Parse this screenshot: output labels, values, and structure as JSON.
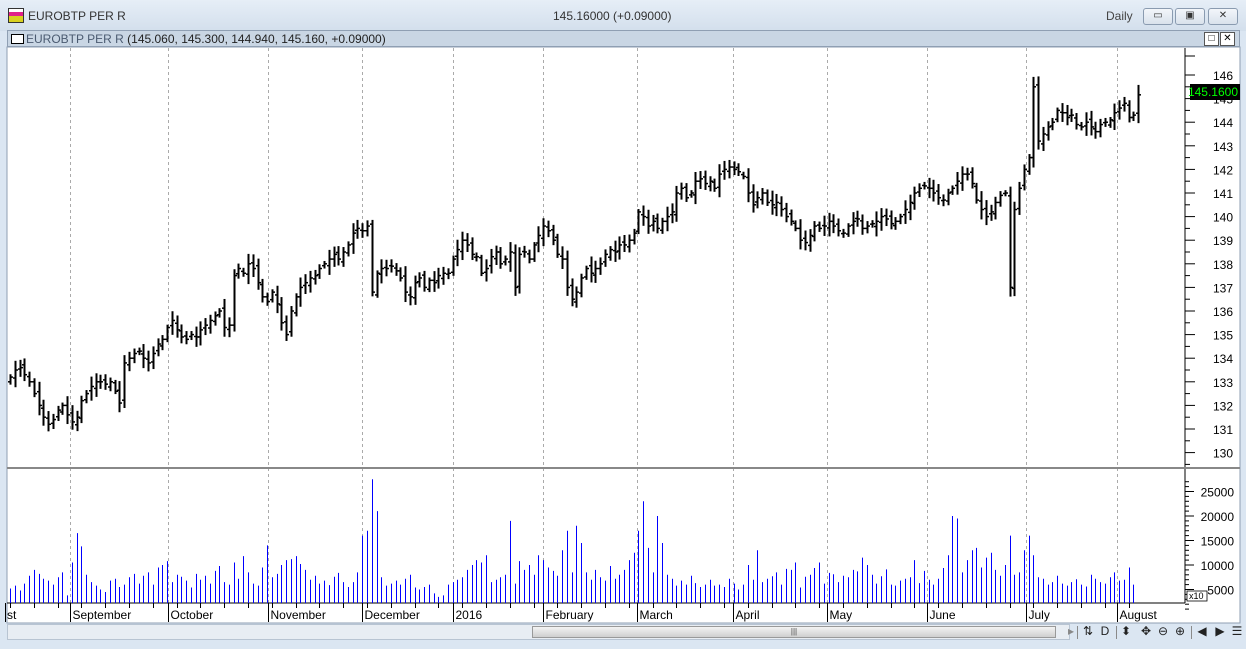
{
  "window": {
    "title": "EUROBTP PER R",
    "last_price_header": "145.16000 (+0.09000)",
    "period": "Daily",
    "minimize": "▭",
    "restore": "▣",
    "close": "✕"
  },
  "chart_window": {
    "symbol": "EUROBTP PER R",
    "ohlc_text": "(145.060, 145.300, 144.940, 145.160, +0.09000)",
    "maximize": "□",
    "close": "✕"
  },
  "chart_data": {
    "type": "ohlc",
    "series_name": "EUROBTP PER R",
    "current_price_label": "145.1600",
    "y_ticks": [
      "130",
      "131",
      "132",
      "133",
      "134",
      "135",
      "136",
      "137",
      "138",
      "139",
      "140",
      "141",
      "142",
      "143",
      "144",
      "145",
      "146"
    ],
    "ylim": [
      129.6,
      147
    ],
    "closes": [
      133.2,
      133.5,
      133.6,
      133.3,
      133.0,
      132.5,
      132.0,
      131.5,
      131.2,
      131.4,
      131.8,
      132.0,
      131.6,
      131.3,
      131.5,
      132.2,
      132.5,
      132.8,
      133.0,
      133.0,
      132.9,
      133.0,
      132.6,
      132.1,
      133.8,
      134.0,
      134.2,
      134.3,
      134.0,
      133.8,
      134.2,
      134.6,
      134.8,
      135.3,
      135.6,
      135.2,
      134.9,
      134.8,
      135.0,
      134.9,
      135.2,
      135.4,
      135.6,
      135.8,
      136.0,
      135.3,
      135.4,
      137.5,
      137.8,
      137.6,
      138.0,
      137.8,
      137.2,
      136.6,
      136.4,
      136.8,
      136.3,
      135.5,
      135.0,
      136.0,
      136.6,
      137.0,
      137.2,
      137.4,
      137.5,
      137.8,
      138.0,
      138.2,
      138.4,
      138.2,
      138.5,
      138.8,
      139.3,
      139.5,
      139.4,
      139.6,
      136.8,
      137.6,
      137.8,
      137.8,
      137.9,
      137.7,
      137.4,
      136.8,
      136.6,
      137.2,
      137.4,
      137.0,
      137.3,
      137.2,
      137.5,
      137.6,
      137.6,
      138.2,
      138.6,
      139.0,
      138.8,
      138.4,
      138.3,
      137.6,
      137.8,
      138.3,
      138.5,
      138.0,
      138.2,
      138.5,
      137.0,
      138.4,
      138.5,
      138.2,
      138.8,
      139.2,
      139.6,
      139.4,
      139.0,
      138.4,
      138.2,
      137.0,
      136.5,
      136.8,
      137.4,
      137.8,
      137.6,
      137.8,
      138.0,
      138.4,
      138.6,
      138.5,
      138.8,
      138.8,
      139.0,
      139.3,
      140.2,
      140.0,
      139.6,
      139.8,
      139.5,
      139.8,
      140.0,
      140.2,
      141.0,
      141.2,
      140.8,
      141.0,
      141.5,
      141.6,
      141.4,
      141.5,
      141.2,
      141.8,
      142.0,
      142.1,
      142.0,
      141.9,
      141.7,
      141.0,
      140.5,
      140.8,
      141.0,
      140.6,
      140.5,
      140.6,
      140.3,
      140.0,
      139.8,
      139.5,
      139.0,
      138.9,
      139.2,
      139.6,
      139.5,
      139.6,
      139.8,
      139.6,
      139.4,
      139.3,
      139.6,
      139.8,
      139.9,
      139.5,
      139.6,
      139.7,
      139.8,
      140.0,
      139.9,
      139.7,
      139.8,
      140.0,
      140.3,
      140.6,
      141.0,
      141.2,
      141.3,
      141.2,
      141.0,
      140.8,
      140.7,
      141.0,
      141.2,
      141.5,
      141.8,
      141.8,
      141.4,
      140.7,
      140.3,
      140.0,
      140.2,
      140.6,
      140.9,
      141.0,
      137.0,
      140.3,
      141.2,
      142.0,
      142.5,
      145.5,
      143.2,
      143.5,
      143.8,
      144.0,
      144.5,
      144.4,
      144.2,
      144.3,
      143.9,
      143.8,
      144.0,
      143.8,
      143.6,
      143.9,
      144.0,
      144.1,
      144.4,
      144.6,
      144.8,
      144.2,
      144.3,
      145.16
    ],
    "volume": {
      "y_ticks": [
        "5000",
        "10000",
        "15000",
        "20000",
        "25000"
      ],
      "multiplier_label": "x10",
      "values": [
        5200,
        5800,
        4800,
        6200,
        7800,
        9000,
        8200,
        7200,
        6800,
        6000,
        7500,
        8500,
        3800,
        10500,
        16500,
        13800,
        8000,
        6500,
        5800,
        5000,
        4500,
        6800,
        7200,
        5500,
        6000,
        7500,
        8200,
        6200,
        7800,
        8500,
        6000,
        9500,
        10000,
        10800,
        6500,
        8000,
        7600,
        6800,
        5400,
        8200,
        7000,
        7800,
        6200,
        8800,
        9800,
        6500,
        6000,
        10500,
        7200,
        11800,
        8500,
        6200,
        5800,
        9500,
        14000,
        7500,
        8200,
        10000,
        11000,
        11200,
        11800,
        10200,
        9000,
        7000,
        7800,
        6200,
        6800,
        5900,
        7600,
        8400,
        6500,
        5500,
        6500,
        8500,
        16000,
        17000,
        27500,
        21000,
        7500,
        5800,
        6200,
        6800,
        6000,
        7200,
        8000,
        5400,
        5000,
        5500,
        6000,
        4200,
        3500,
        3800,
        6000,
        6500,
        7000,
        7500,
        9000,
        10000,
        11000,
        10500,
        12000,
        6500,
        7000,
        7500,
        8000,
        19000,
        6200,
        10800,
        9000,
        10000,
        8000,
        12000,
        11000,
        9500,
        8800,
        7800,
        13000,
        17000,
        8500,
        18000,
        14500,
        8500,
        7000,
        9000,
        7500,
        6800,
        9800,
        7200,
        8000,
        9000,
        11000,
        12500,
        17000,
        23000,
        13500,
        8500,
        20000,
        14500,
        8000,
        7200,
        5800,
        6800,
        6000,
        7800,
        6300,
        5500,
        6000,
        7000,
        5800,
        6000,
        5500,
        7200,
        6200,
        5000,
        6000,
        10000,
        7000,
        13000,
        6500,
        7200,
        7700,
        8500,
        6000,
        9200,
        9000,
        10500,
        5400,
        7600,
        8000,
        9400,
        10500,
        6200,
        8400,
        8100,
        6500,
        7800,
        7500,
        9000,
        8700,
        11500,
        10000,
        8000,
        6200,
        7700,
        9100,
        6000,
        5800,
        6800,
        7200,
        7500,
        11000,
        6300,
        8800,
        7000,
        6000,
        7200,
        9400,
        12000,
        20000,
        19500,
        8500,
        11000,
        13000,
        13500,
        9500,
        11500,
        12500,
        9000,
        7800,
        10000,
        16000,
        8000,
        8500,
        13000,
        16000,
        12000,
        7500,
        7200,
        6000,
        6500,
        7800,
        6200,
        5800,
        6500,
        7100,
        6000,
        5600,
        8000,
        7200,
        6500,
        6200,
        7500,
        8500,
        6800,
        7000,
        9500,
        6000
      ]
    },
    "x_labels": [
      {
        "label": "st",
        "bar": -1
      },
      {
        "label": "September",
        "bar": 12.6
      },
      {
        "label": "October",
        "bar": 33.2
      },
      {
        "label": "November",
        "bar": 54.2
      },
      {
        "label": "December",
        "bar": 74
      },
      {
        "label": "2016",
        "bar": 93
      },
      {
        "label": "February",
        "bar": 112
      },
      {
        "label": "March",
        "bar": 131.7
      },
      {
        "label": "April",
        "bar": 151.9
      },
      {
        "label": "May",
        "bar": 171.6
      },
      {
        "label": "June",
        "bar": 192.6
      },
      {
        "label": "July",
        "bar": 213.4
      },
      {
        "label": "August",
        "bar": 232.6
      }
    ]
  },
  "toolbar": {
    "scroll_right": "▸",
    "refresh": "⇅",
    "data": "D",
    "vzoom": "⬍",
    "move": "✥",
    "zoom_out": "⊖",
    "zoom_in": "⊕",
    "prev": "◀",
    "next": "▶",
    "menu": "☰",
    "scroll_grip": "|||"
  },
  "colors": {
    "volume": "#0000ff",
    "price_label_bg": "#000000",
    "price_label_fg": "#00ff00"
  }
}
